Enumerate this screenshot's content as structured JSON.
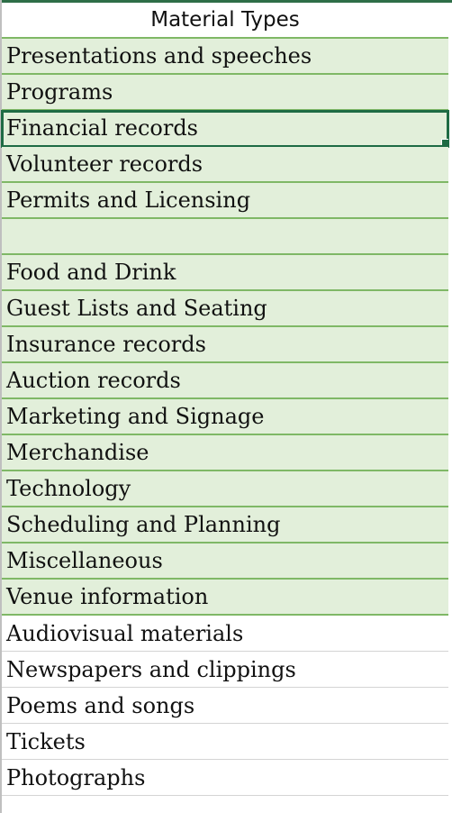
{
  "header": {
    "title": "Material Types"
  },
  "rows": [
    {
      "label": "Presentations and speeches",
      "style": "green"
    },
    {
      "label": "Programs",
      "style": "green"
    },
    {
      "label": "Financial records",
      "style": "green",
      "selected": true
    },
    {
      "label": "Volunteer records",
      "style": "green"
    },
    {
      "label": "Permits and Licensing",
      "style": "green"
    },
    {
      "label": "",
      "style": "green"
    },
    {
      "label": "Food and Drink",
      "style": "green"
    },
    {
      "label": "Guest Lists and Seating",
      "style": "green"
    },
    {
      "label": "Insurance records",
      "style": "green"
    },
    {
      "label": "Auction records",
      "style": "green"
    },
    {
      "label": "Marketing and Signage",
      "style": "green"
    },
    {
      "label": "Merchandise",
      "style": "green"
    },
    {
      "label": "Technology",
      "style": "green"
    },
    {
      "label": "Scheduling and Planning",
      "style": "green"
    },
    {
      "label": "Miscellaneous",
      "style": "green"
    },
    {
      "label": "Venue information",
      "style": "green"
    },
    {
      "label": "Audiovisual materials",
      "style": "plain"
    },
    {
      "label": "Newspapers and clippings",
      "style": "plain"
    },
    {
      "label": "Poems and songs",
      "style": "plain"
    },
    {
      "label": "Tickets",
      "style": "plain"
    },
    {
      "label": "Photographs",
      "style": "plain"
    },
    {
      "label": "",
      "style": "plain"
    }
  ],
  "colors": {
    "header_rule": "#2e6e47",
    "band_fill": "#e2efda",
    "band_border": "#7fb866",
    "selection": "#1e6b44"
  }
}
